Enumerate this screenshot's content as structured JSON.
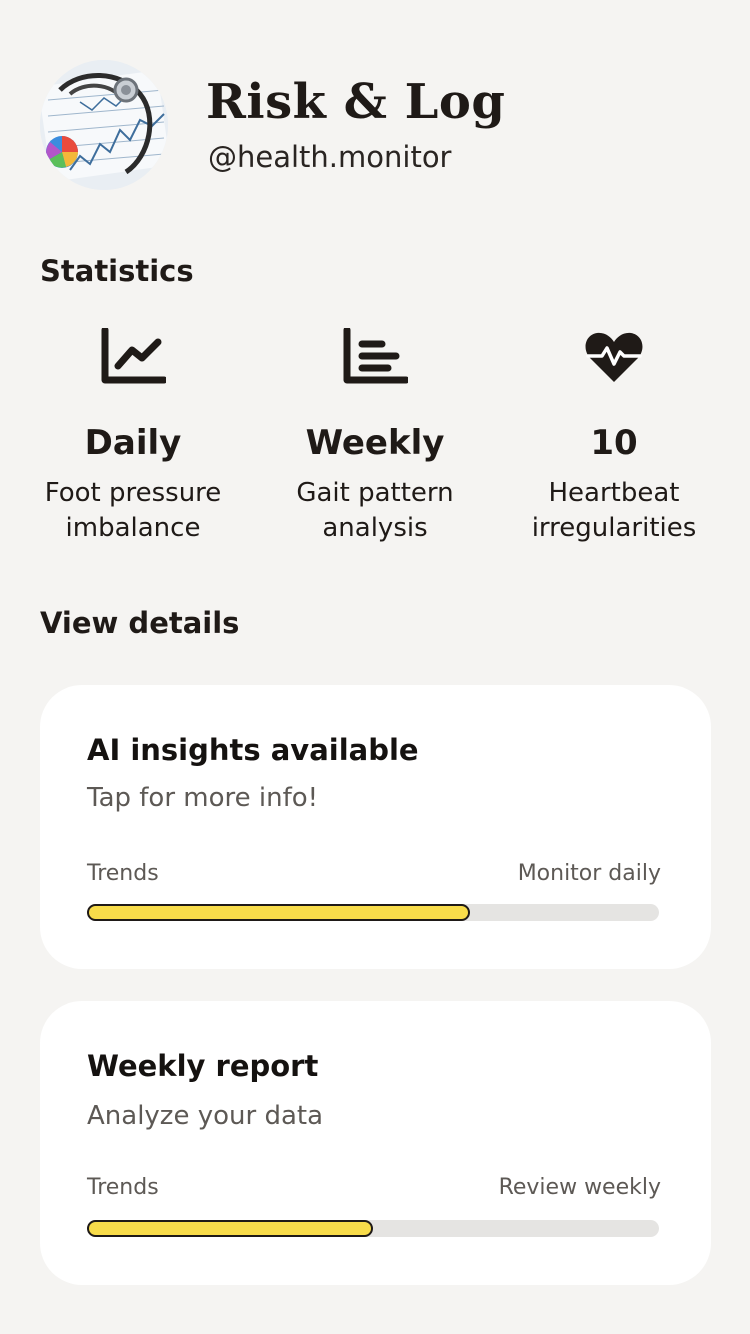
{
  "header": {
    "title": "Risk & Log",
    "handle": "@health.monitor",
    "avatar_icon": "medical-chart-stethoscope-image"
  },
  "statistics": {
    "title": "Statistics",
    "items": [
      {
        "icon": "line-chart-icon",
        "value": "Daily",
        "desc_line1": "Foot pressure",
        "desc_line2": "imbalance"
      },
      {
        "icon": "bar-list-chart-icon",
        "value": "Weekly",
        "desc_line1": "Gait pattern",
        "desc_line2": "analysis"
      },
      {
        "icon": "heartbeat-icon",
        "value": "10",
        "desc_line1": "Heartbeat",
        "desc_line2": "irregularities"
      }
    ]
  },
  "details": {
    "title": "View details",
    "cards": [
      {
        "title": "AI insights available",
        "subtitle": "Tap for more info!",
        "label_left": "Trends",
        "label_right": "Monitor daily",
        "progress": 0.67
      },
      {
        "title": "Weekly report",
        "subtitle": "Analyze your data",
        "label_left": "Trends",
        "label_right": "Review weekly",
        "progress": 0.5
      }
    ]
  },
  "colors": {
    "background": "#f5f4f2",
    "card": "#ffffff",
    "accent_yellow": "#f8dc4a",
    "text_dark": "#1f1a17",
    "text_muted": "#5d5955",
    "track": "#e5e4e2"
  }
}
